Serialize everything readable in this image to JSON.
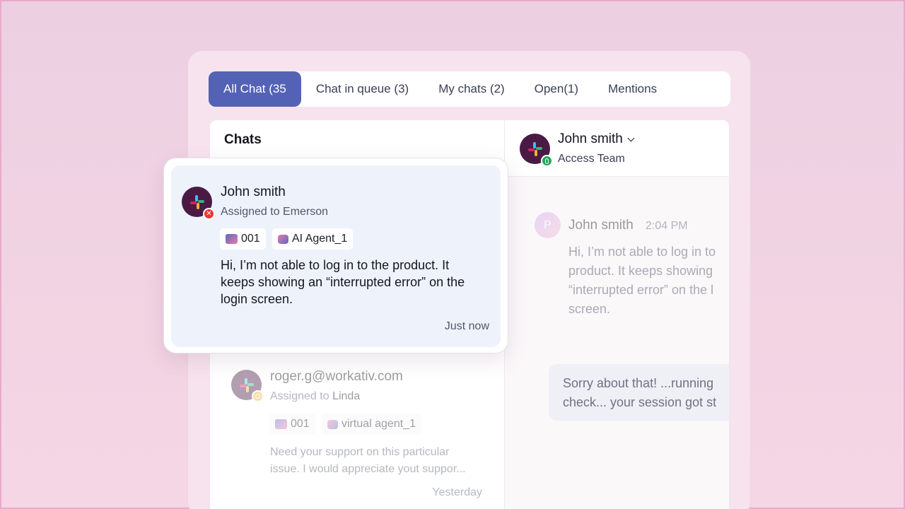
{
  "tabs": [
    {
      "label": "All Chat (35",
      "active": true
    },
    {
      "label": "Chat in queue (3)",
      "active": false
    },
    {
      "label": "My chats (2)",
      "active": false
    },
    {
      "label": "Open(1)",
      "active": false
    },
    {
      "label": "Mentions",
      "active": false
    }
  ],
  "chats_panel": {
    "title": "Chats"
  },
  "popup_chat": {
    "name": "John smith",
    "assigned": "Assigned to Emerson",
    "ticket_chip": "001",
    "agent_chip": "AI Agent_1",
    "message_lines": [
      "Hi, I’m not able to log in to the product. It",
      "keeps showing an “interrupted error” on the",
      "login screen."
    ],
    "time": "Just now",
    "status_icon": "error-x-icon",
    "status_color": "#e53935"
  },
  "second_chat": {
    "name": "roger.g@workativ.com",
    "assigned_prefix": "Assigned to ",
    "assigned_name": "Linda",
    "ticket_chip": "001",
    "agent_chip": "virtual agent_1",
    "message_lines": [
      "Need your support on this particular",
      "issue. I  would appreciate yout suppor..."
    ],
    "time": "Yesterday",
    "status_icon": "clock-icon",
    "status_color": "#f3b23c"
  },
  "conversation": {
    "header_name": "John smith",
    "header_team": "Access Team",
    "header_status_color": "#22a55a",
    "message_sender_initial": "P",
    "message_sender": "John smith",
    "message_time": "2:04 PM",
    "message_lines": [
      "Hi, I’m not able to log in to",
      "product. It keeps showing",
      "“interrupted error” on the l",
      "screen."
    ],
    "reply_lines": [
      "Sorry about that! ...running",
      "check... your session got st"
    ]
  },
  "colors": {
    "accent": "#5462b5",
    "slack_bg": "#4a1a45"
  }
}
